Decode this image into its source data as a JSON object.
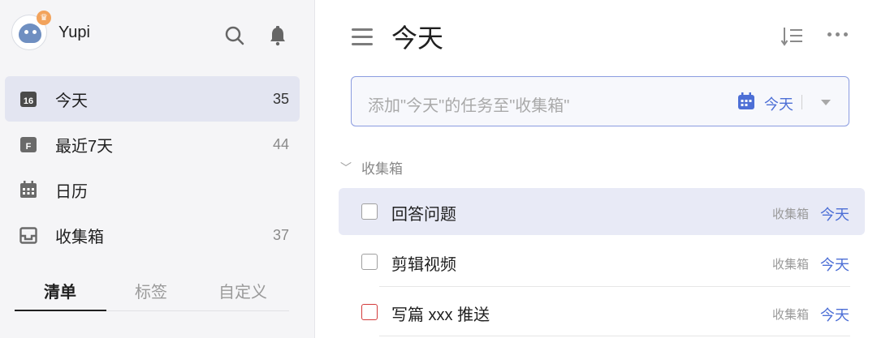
{
  "sidebar": {
    "profile": {
      "name": "Yupi"
    },
    "items": [
      {
        "icon": "calendar-today-icon",
        "badge": "16",
        "label": "今天",
        "count": "35",
        "active": true
      },
      {
        "icon": "next-7-days-icon",
        "badge": "F",
        "label": "最近7天",
        "count": "44",
        "active": false
      },
      {
        "icon": "calendar-icon",
        "label": "日历",
        "count": "",
        "active": false
      },
      {
        "icon": "inbox-icon",
        "label": "收集箱",
        "count": "37",
        "active": false
      }
    ],
    "tabs": [
      {
        "label": "清单",
        "active": true
      },
      {
        "label": "标签",
        "active": false
      },
      {
        "label": "自定义",
        "active": false
      }
    ]
  },
  "main": {
    "title": "今天",
    "add_task": {
      "placeholder": "添加\"今天\"的任务至\"收集箱\"",
      "date_label": "今天"
    },
    "section": {
      "label": "收集箱"
    },
    "tasks": [
      {
        "title": "回答问题",
        "list": "收集箱",
        "due": "今天",
        "priority": "none",
        "highlighted": true
      },
      {
        "title": "剪辑视频",
        "list": "收集箱",
        "due": "今天",
        "priority": "none",
        "highlighted": false
      },
      {
        "title": "写篇 xxx 推送",
        "list": "收集箱",
        "due": "今天",
        "priority": "high",
        "highlighted": false
      }
    ]
  },
  "colors": {
    "accent": "#4d6fd6",
    "active_bg": "#e3e5f1",
    "high_priority": "#d33b3b",
    "sidebar_bg": "#f5f5f7"
  }
}
